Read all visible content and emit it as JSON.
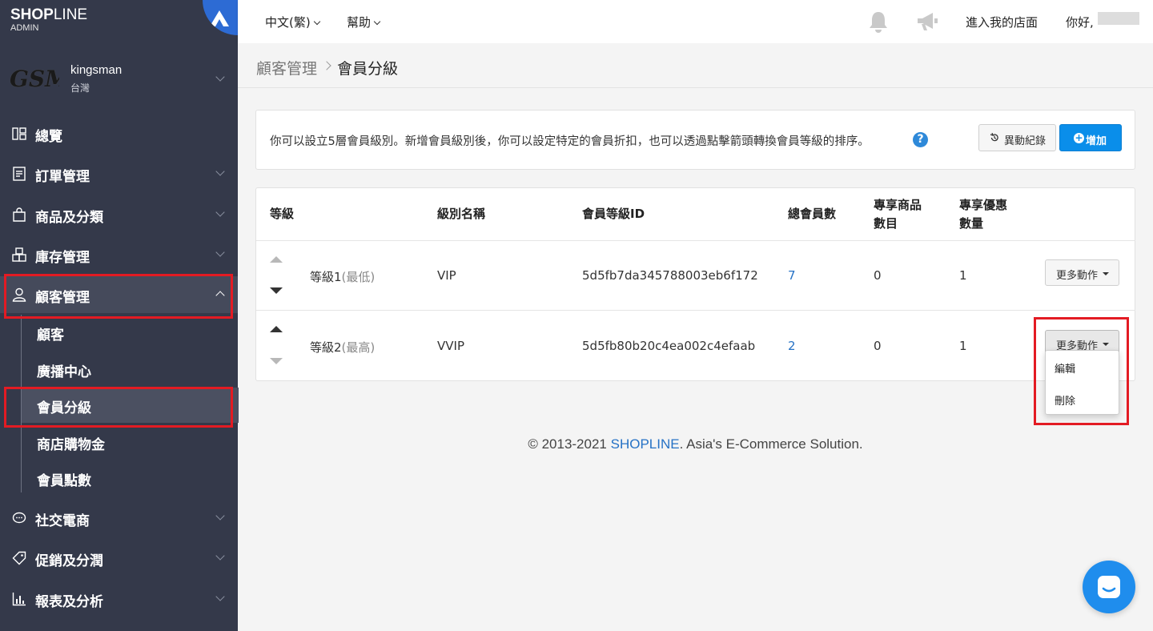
{
  "brand": {
    "name_bold": "SHOP",
    "name_thin": "LINE",
    "sub": "ADMIN"
  },
  "store": {
    "logo_text": "GSM",
    "name": "kingsman",
    "region": "台灣"
  },
  "sidebar": {
    "items": [
      {
        "label": "總覽",
        "icon": "dashboard-icon"
      },
      {
        "label": "訂單管理",
        "icon": "order-icon"
      },
      {
        "label": "商品及分類",
        "icon": "bag-icon"
      },
      {
        "label": "庫存管理",
        "icon": "inventory-icon"
      },
      {
        "label": "顧客管理",
        "icon": "user-icon"
      },
      {
        "label": "社交電商",
        "icon": "chat-icon"
      },
      {
        "label": "促銷及分潤",
        "icon": "tag-icon"
      },
      {
        "label": "報表及分析",
        "icon": "chart-icon"
      }
    ],
    "sub_items": [
      {
        "label": "顧客"
      },
      {
        "label": "廣播中心"
      },
      {
        "label": "會員分級"
      },
      {
        "label": "商店購物金"
      },
      {
        "label": "會員點數"
      }
    ]
  },
  "topbar": {
    "language": "中文(繁)",
    "help": "幫助",
    "enter_store": "進入我的店面",
    "greeting": "你好,"
  },
  "breadcrumb": {
    "parent": "顧客管理",
    "current": "會員分級"
  },
  "info": {
    "text": "你可以設立5層會員級別。新增會員級別後，你可以設定特定的會員折扣，也可以透過點擊箭頭轉換會員等級的排序。",
    "history_button": "異動紀錄",
    "add_button": "增加"
  },
  "table": {
    "headers": {
      "level": "等級",
      "name": "級別名稱",
      "id": "會員等級ID",
      "members": "總會員數",
      "products_1": "專享商品",
      "products_2": "數目",
      "promos_1": "專享優惠",
      "promos_2": "數量"
    },
    "rows": [
      {
        "level": "等級1",
        "level_note": "(最低)",
        "name": "VIP",
        "id": "5d5fb7da345788003eb6f172",
        "members": "7",
        "products": "0",
        "promos": "1",
        "action": "更多動作"
      },
      {
        "level": "等級2",
        "level_note": "(最高)",
        "name": "VVIP",
        "id": "5d5fb80b20c4ea002c4efaab",
        "members": "2",
        "products": "0",
        "promos": "1",
        "action": "更多動作"
      }
    ]
  },
  "dropdown": {
    "edit": "編輯",
    "delete": "刪除"
  },
  "footer": {
    "prefix": "© 2013-2021 ",
    "brand": "SHOPLINE",
    "suffix": ". Asia's E-Commerce Solution."
  },
  "colors": {
    "sidebar": "#34394a",
    "accent": "#0a8eea",
    "highlight": "#e31b23",
    "link": "#2672c5"
  }
}
